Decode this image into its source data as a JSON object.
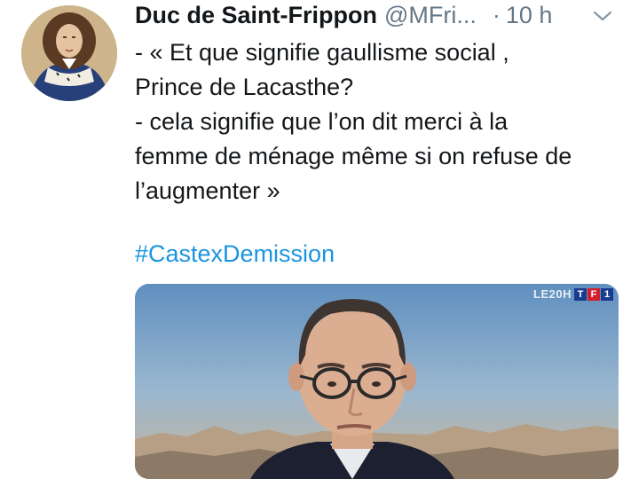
{
  "tweet": {
    "display_name": "Duc de Saint-Frippon",
    "handle": "@MFri...",
    "separator": "·",
    "time": "10 h",
    "lines": [
      "- «  Et que signifie gaullisme social ,",
      "Prince de Lacasthe?",
      "- cela signifie que l’on dit merci à la",
      "femme de ménage même si on refuse de",
      "l’augmenter »"
    ],
    "hashtag": "#CastexDemission",
    "media": {
      "logo_text": "LE20H",
      "channel_letters": [
        "T",
        "F",
        "1"
      ],
      "channel_colors": [
        "#1a3c8f",
        "#d21f2b",
        "#1a3c8f"
      ]
    }
  },
  "icons": {
    "avatar": "portrait-avatar",
    "menu": "chevron-down-icon"
  },
  "colors": {
    "text": "#14171a",
    "secondary": "#657786",
    "link": "#1b95e0"
  }
}
